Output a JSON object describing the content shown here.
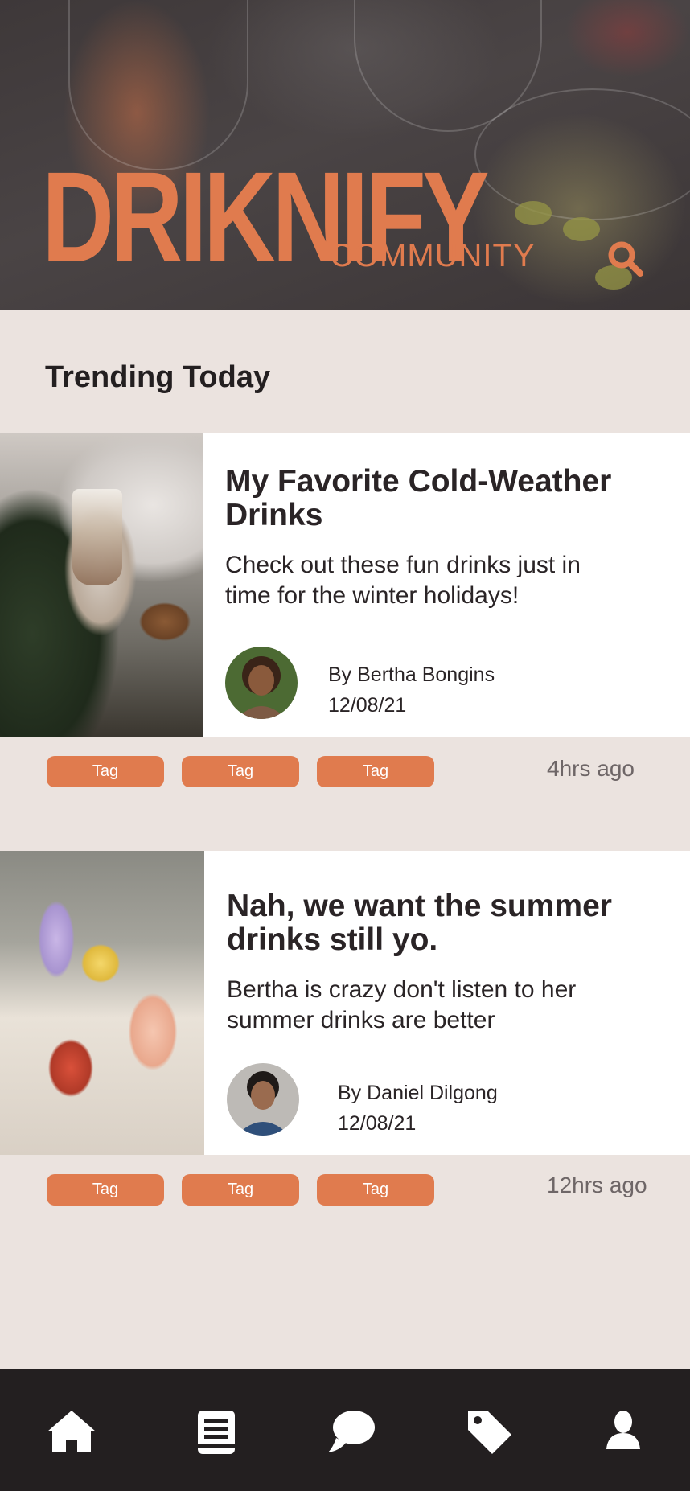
{
  "header": {
    "logo_text": "DRIKNIFY",
    "logo_sub": "COMMUNITY",
    "search_icon": "search-icon",
    "accent_color": "#e07b4e"
  },
  "section": {
    "title": "Trending Today"
  },
  "posts": [
    {
      "title": "My Favorite Cold-Weather Drinks",
      "description": "Check out these fun drinks just in time for the winter holidays!",
      "author": "By Bertha Bongins",
      "date": "12/08/21",
      "tags": [
        "Tag",
        "Tag",
        "Tag"
      ],
      "time_ago": "4hrs ago"
    },
    {
      "title": "Nah, we want the summer drinks still yo.",
      "description": "Bertha is crazy don't listen to her summer drinks are better",
      "author": "By Daniel Dilgong",
      "date": "12/08/21",
      "tags": [
        "Tag",
        "Tag",
        "Tag"
      ],
      "time_ago": "12hrs ago"
    }
  ],
  "bottom_nav": {
    "items": [
      "home-icon",
      "book-icon",
      "chat-icon",
      "tag-icon",
      "profile-icon"
    ]
  }
}
